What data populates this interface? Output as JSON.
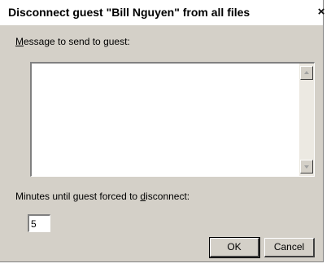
{
  "window": {
    "title": "Disconnect guest \"Bill Nguyen\" from all files",
    "close_glyph": "×"
  },
  "message": {
    "label_mnemonic": "M",
    "label_rest": "essage to send to guest:",
    "value": ""
  },
  "minutes": {
    "label_before": "Minutes until guest forced to ",
    "label_mnemonic": "d",
    "label_after": "isconnect:",
    "value": "5"
  },
  "buttons": {
    "ok_label": "OK",
    "cancel_label": "Cancel"
  },
  "colors": {
    "dialog_bg": "#d4d0c8",
    "title_bg": "#ffffff",
    "field_bg": "#ffffff",
    "shadow": "#808080"
  }
}
